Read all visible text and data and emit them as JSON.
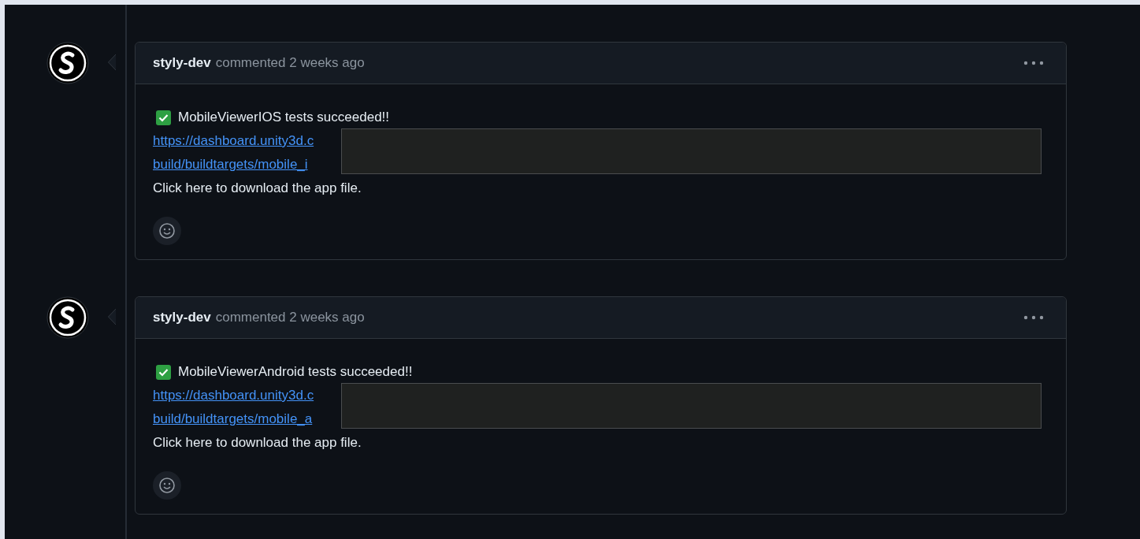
{
  "comments": [
    {
      "author": "styly-dev",
      "action": "commented 2 weeks ago",
      "status_text": "MobileViewerIOS tests succeeded!!",
      "checked": true,
      "link_lines": [
        "https://dashboard.unity3d.c",
        "build/buildtargets/mobile_i"
      ],
      "note": "Click here to download the app file."
    },
    {
      "author": "styly-dev",
      "action": "commented 2 weeks ago",
      "status_text": "MobileViewerAndroid tests succeeded!!",
      "checked": true,
      "link_lines": [
        "https://dashboard.unity3d.c",
        "build/buildtargets/mobile_a"
      ],
      "note": "Click here to download the app file."
    }
  ]
}
